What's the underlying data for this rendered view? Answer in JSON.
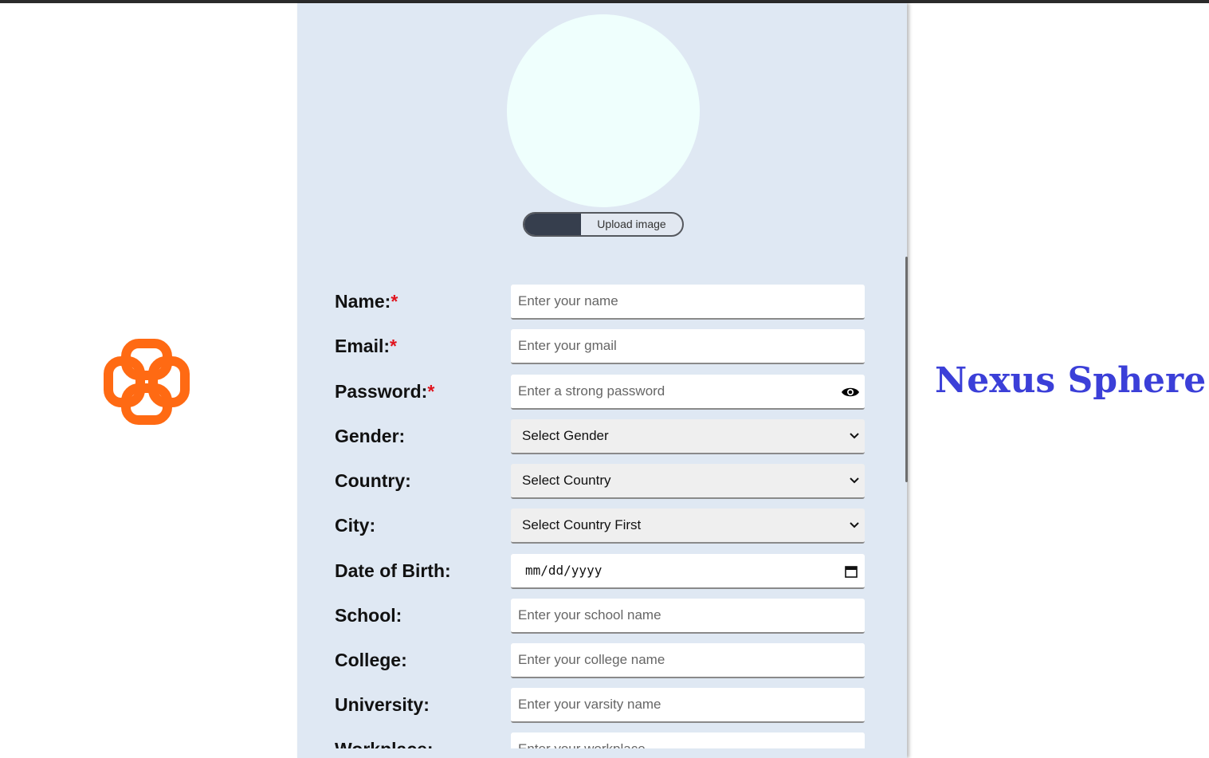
{
  "brand": {
    "name": "Nexus Sphere",
    "color": "#3b3fd8",
    "logo_icon": "orange-interlocked-squares-logo",
    "logo_color": "#ff6a13"
  },
  "upload": {
    "label": "Upload image"
  },
  "form": {
    "required_mark": "*",
    "fields": [
      {
        "label": "Name:",
        "required": true,
        "type": "text",
        "placeholder": "Enter your name"
      },
      {
        "label": "Email:",
        "required": true,
        "type": "text",
        "placeholder": "Enter your gmail"
      },
      {
        "label": "Password:",
        "required": true,
        "type": "password",
        "placeholder": "Enter a strong password",
        "icon": "eye-icon"
      },
      {
        "label": "Gender:",
        "required": false,
        "type": "select",
        "value": "Select Gender"
      },
      {
        "label": "Country:",
        "required": false,
        "type": "select",
        "value": "Select Country"
      },
      {
        "label": "City:",
        "required": false,
        "type": "select",
        "value": "Select Country First"
      },
      {
        "label": "Date of Birth:",
        "required": false,
        "type": "date",
        "value": "mm/dd/yyyy",
        "icon": "calendar-icon"
      },
      {
        "label": "School:",
        "required": false,
        "type": "text",
        "placeholder": "Enter your school name"
      },
      {
        "label": "College:",
        "required": false,
        "type": "text",
        "placeholder": "Enter your college name"
      },
      {
        "label": "University:",
        "required": false,
        "type": "text",
        "placeholder": "Enter your varsity name"
      },
      {
        "label": "Workplace:",
        "required": false,
        "type": "text",
        "placeholder": "Enter your workplace"
      }
    ]
  },
  "colors": {
    "panel": "#dfe8f3",
    "required": "#e0141e",
    "avatar": "#effffd"
  }
}
